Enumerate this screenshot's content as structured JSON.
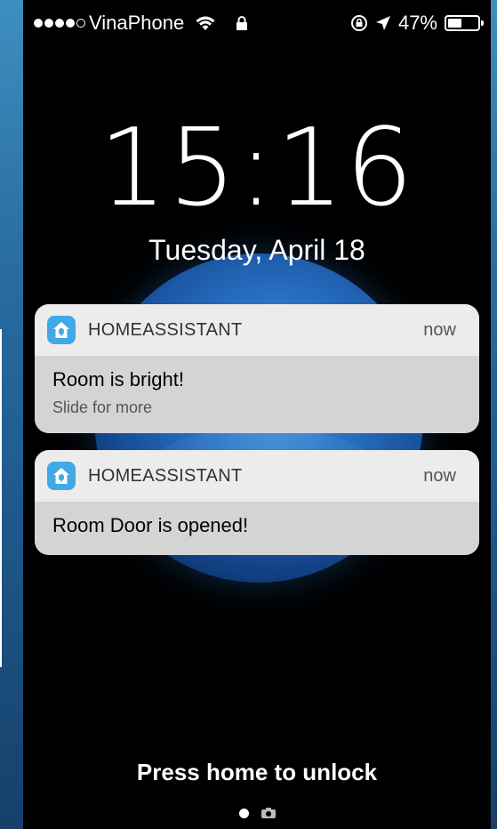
{
  "status_bar": {
    "carrier": "VinaPhone",
    "battery_percent": "47%",
    "battery_level": 0.47,
    "signal_bars_filled": 4,
    "signal_bars_total": 5,
    "icons": [
      "wifi-icon",
      "lock-icon",
      "rotation-lock-icon",
      "location-icon",
      "battery-icon"
    ]
  },
  "lock_screen": {
    "time": "15:16",
    "date": "Tuesday, April 18",
    "unlock_hint": "Press home to unlock"
  },
  "notifications": [
    {
      "app_name": "HOMEASSISTANT",
      "time": "now",
      "title": "Room is bright!",
      "subtitle": "Slide for more"
    },
    {
      "app_name": "HOMEASSISTANT",
      "time": "now",
      "title": "Room Door is opened!"
    }
  ],
  "colors": {
    "app_icon": "#41a9e8",
    "background": "#000000"
  }
}
